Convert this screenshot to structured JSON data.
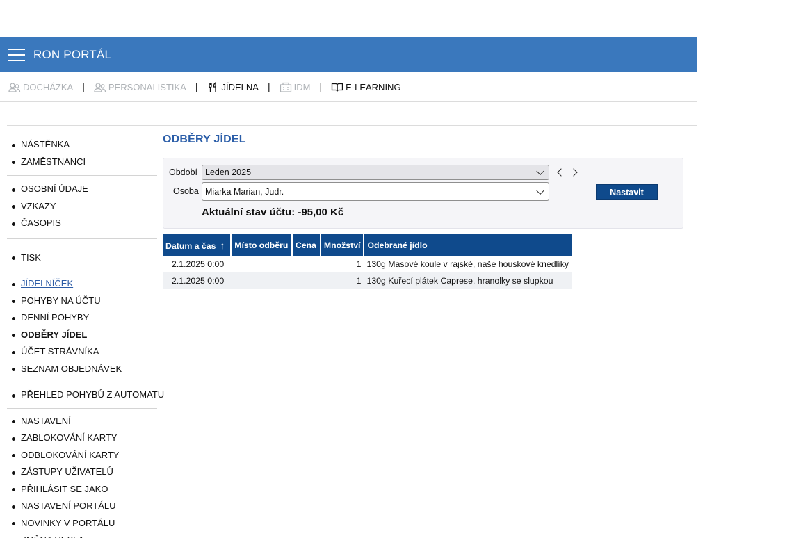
{
  "app": {
    "title": "RON PORTÁL"
  },
  "modules": [
    {
      "label": "DOCHÁZKA",
      "icon": "users-icon",
      "enabled": false
    },
    {
      "label": "PERSONALISTIKA",
      "icon": "users-icon",
      "enabled": false
    },
    {
      "label": "JÍDELNA",
      "icon": "cutlery-icon",
      "enabled": true
    },
    {
      "label": "IDM",
      "icon": "building-icon",
      "enabled": false
    },
    {
      "label": "E-LEARNING",
      "icon": "book-icon",
      "enabled": true
    }
  ],
  "sidebar": {
    "group1": [
      "NÁSTĚNKA",
      "ZAMĚSTNANCI"
    ],
    "group2": [
      "OSOBNÍ ÚDAJE",
      "VZKAZY",
      "ČASOPIS"
    ],
    "group3": [
      "TISK"
    ],
    "group4": [
      "JÍDELNÍČEK",
      "POHYBY NA ÚČTU",
      "DENNÍ POHYBY",
      "ODBĚRY JÍDEL",
      "ÚČET STRÁVNÍKA",
      "SEZNAM OBJEDNÁVEK"
    ],
    "group5": [
      "PŘEHLED POHYBŮ Z AUTOMATU"
    ],
    "group6": [
      "NASTAVENÍ",
      "ZABLOKOVÁNÍ KARTY",
      "ODBLOKOVÁNÍ KARTY",
      "ZÁSTUPY UŽIVATELŮ",
      "PŘIHLÁSIT SE JAKO",
      "NASTAVENÍ PORTÁLU",
      "NOVINKY V PORTÁLU",
      "ZMĚNA HESLA"
    ]
  },
  "page": {
    "title": "ODBĚRY JÍDEL"
  },
  "filters": {
    "period_label": "Období",
    "period_value": "Leden 2025",
    "person_label": "Osoba",
    "person_value": "Miarka Marian, Judr.",
    "set_button": "Nastavit",
    "balance": "Aktuální stav účtu: -95,00 Kč"
  },
  "table": {
    "columns": [
      "Datum a čas",
      "Místo odběru",
      "Cena",
      "Množství",
      "Odebrané jídlo"
    ],
    "sort_indicator": "↑",
    "rows": [
      {
        "date": "2.1.2025 0:00",
        "place": "",
        "price": "",
        "qty": "1",
        "meal": "130g Masové koule v rajské, naše houskové knedlíky"
      },
      {
        "date": "2.1.2025 0:00",
        "place": "",
        "price": "",
        "qty": "1",
        "meal": "130g Kuřecí plátek Caprese, hranolky se slupkou"
      }
    ]
  },
  "colors": {
    "header": "#3a78bd",
    "accent": "#0f4a8c",
    "title": "#2a5da8"
  }
}
